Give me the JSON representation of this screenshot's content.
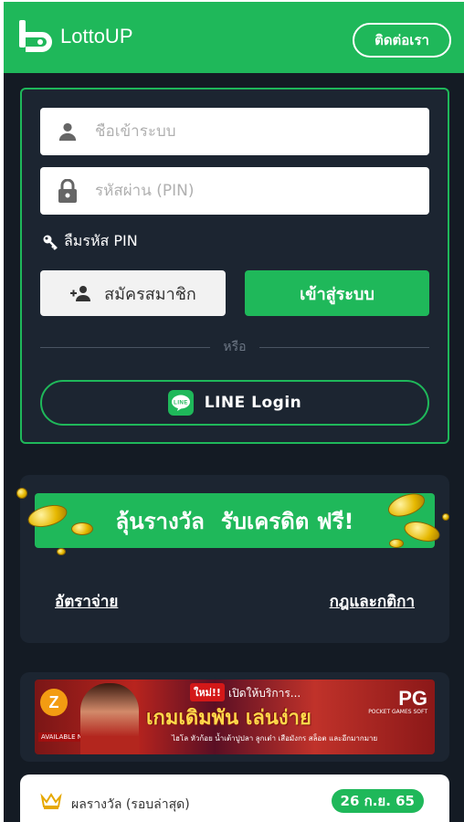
{
  "header": {
    "logo_text": "LottoUP",
    "contact_label": "ติดต่อเรา"
  },
  "login": {
    "username_placeholder": "ชื่อเข้าระบบ",
    "pin_placeholder": "รหัสผ่าน (PIN)",
    "forgot_pin": "ลืมรหัส PIN",
    "register_label": "สมัครสมาชิก",
    "login_label": "เข้าสู่ระบบ",
    "or_label": "หรือ",
    "line_login_label": "LINE Login",
    "line_logo_text": "LINE"
  },
  "promo": {
    "banner_part1": "ลุ้นรางวัล",
    "banner_part2": "รับเครดิต ฟรี!",
    "payout_link": "อัตราจ่าย",
    "rules_link": "กฎและกติกา"
  },
  "game_banner": {
    "badge_new": "ใหม่!!",
    "open_text": "เปิดให้บริการ...",
    "title": "เกมเดิมพัน เล่นง่าย",
    "subtitle": "ไฮโล หัวก้อย น้ำเต้าปูปลา ลูกเต๋า เสือมังกร สล็อต และอีกมากมาย",
    "pg_text": "PG",
    "pg_sub": "POCKET GAMES SOFT",
    "available_text": "AVAILABLE NOW",
    "z_text": "Z"
  },
  "results": {
    "title": "ผลรางวัล (รอบล่าสุด)",
    "date": "26 ก.ย. 65"
  },
  "colors": {
    "brand_green": "#1fb85a",
    "dark_bg": "#141b24",
    "card_bg": "#1c2531"
  }
}
